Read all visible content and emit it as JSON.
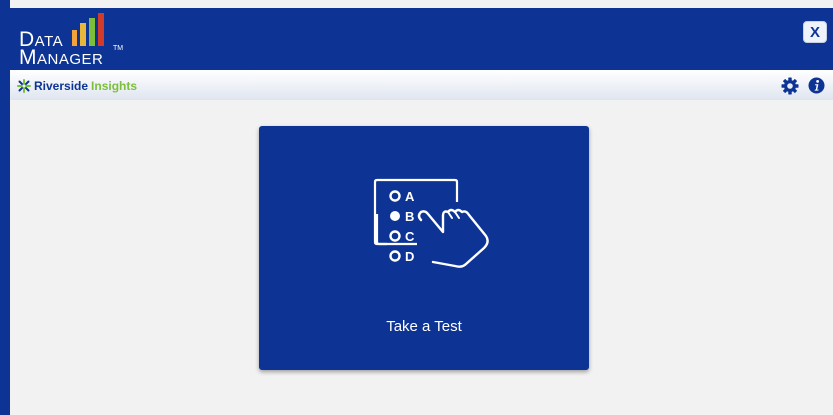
{
  "header": {
    "logo": {
      "word1_initial": "D",
      "word1_rest": "ATA",
      "word2_initial": "M",
      "word2_rest": "ANAGER",
      "trademark": "TM",
      "bar_colors": [
        "#f2a33a",
        "#e6b73a",
        "#7bbf3a",
        "#d23a2a"
      ]
    },
    "close_label": "X"
  },
  "subheader": {
    "brand_part1": "Riverside",
    "brand_part2": "Insights"
  },
  "card": {
    "label": "Take a Test",
    "options": [
      "A",
      "B",
      "C",
      "D"
    ]
  },
  "colors": {
    "primary": "#0d3494",
    "brand_green": "#7bbf3a",
    "background": "#f2f2f2"
  }
}
